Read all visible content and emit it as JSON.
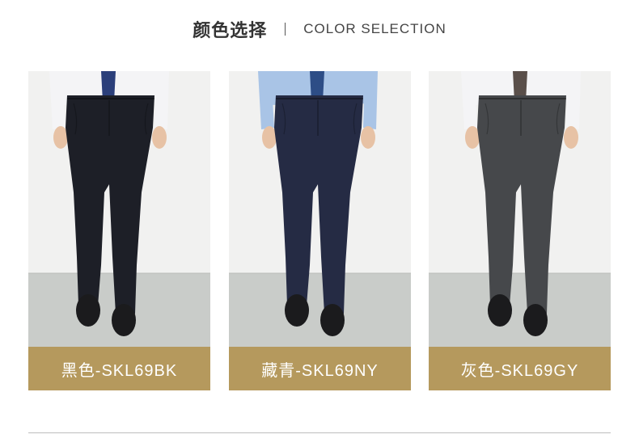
{
  "header": {
    "title_cn": "颜色选择",
    "title_en": "COLOR SELECTION"
  },
  "colors": {
    "label_bg": "#b5995d",
    "wall": "#f1f1f0",
    "floor": "#c9ccc9",
    "shirt_white": "#f4f4f6",
    "shirt_blue": "#a9c4e6",
    "shoe": "#1b1b1d"
  },
  "products": [
    {
      "label": "黑色-SKL69BK",
      "pants_color": "#1d1f27",
      "tie_color": "#2b3f7a",
      "shirt_color": "#f4f4f6"
    },
    {
      "label": "藏青-SKL69NY",
      "pants_color": "#252b44",
      "tie_color": "#2d4d86",
      "shirt_color": "#a9c4e6"
    },
    {
      "label": "灰色-SKL69GY",
      "pants_color": "#46484b",
      "tie_color": "#5a4f4a",
      "shirt_color": "#f4f4f6"
    }
  ]
}
